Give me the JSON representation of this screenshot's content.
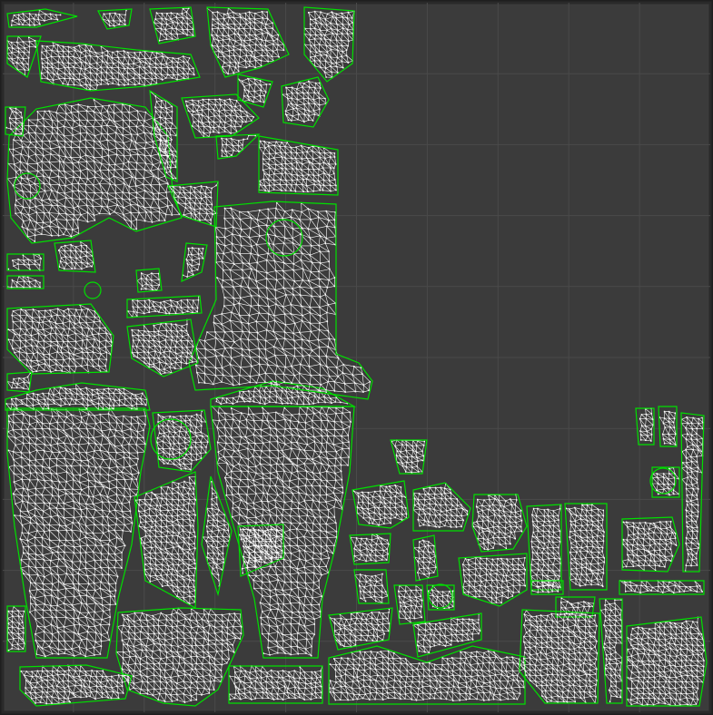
{
  "editor": {
    "view": "UV layout",
    "grid_divisions": 10,
    "colors": {
      "background": "#1f1f1f",
      "uv_space": "#3b3b3b",
      "grid_line": "#4a4a4a",
      "border": "#2a2a2a",
      "wire": "#ffffff",
      "boundary": "#00e000",
      "vertex": "#ffffff"
    }
  }
}
